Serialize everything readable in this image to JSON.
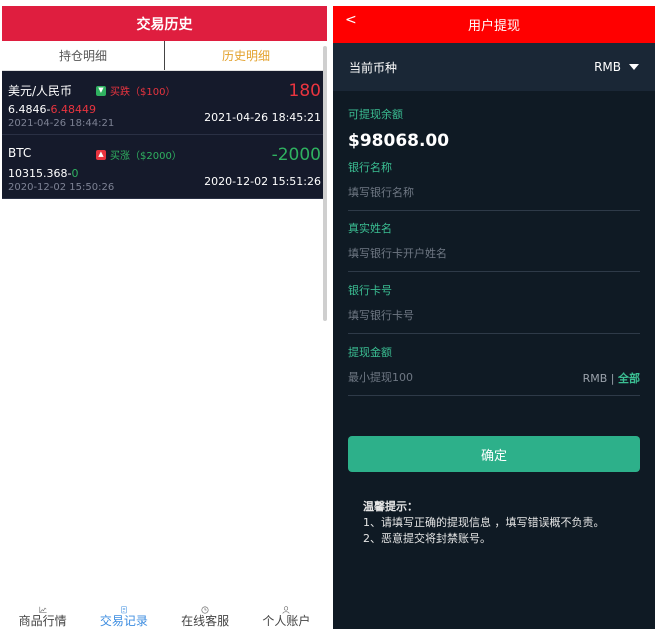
{
  "left": {
    "title": "交易历史",
    "tabs": [
      {
        "label": "持仓明细",
        "active": false
      },
      {
        "label": "历史明细",
        "active": true
      }
    ],
    "orders": [
      {
        "name": "美元/人民币",
        "direction": "down",
        "badge_label": "买跌（$100）",
        "open_price": "6.4846",
        "close_price": "6.48449",
        "open_time": "2021-04-26 18:44:21",
        "profit": "180",
        "close_time": "2021-04-26 18:45:21"
      },
      {
        "name": "BTC",
        "direction": "up",
        "badge_label": "买涨（$2000）",
        "open_price": "10315.368",
        "close_price": "0",
        "open_time": "2020-12-02 15:50:26",
        "profit": "-2000",
        "close_time": "2020-12-02 15:51:26"
      }
    ],
    "nav": [
      {
        "label": "商品行情",
        "icon": "chart-icon",
        "active": false
      },
      {
        "label": "交易记录",
        "icon": "records-icon",
        "active": true
      },
      {
        "label": "在线客服",
        "icon": "clock-icon",
        "active": false
      },
      {
        "label": "个人账户",
        "icon": "user-icon",
        "active": false
      }
    ]
  },
  "right": {
    "title": "用户提现",
    "back_icon": "chevron-left-icon",
    "currency_label": "当前币种",
    "currency_value": "RMB",
    "balance_label": "可提现余额",
    "balance": "$98068.00",
    "bank_name_label": "银行名称",
    "bank_name_placeholder": "填写银行名称",
    "real_name_label": "真实姓名",
    "real_name_placeholder": "填写银行卡开户姓名",
    "card_label": "银行卡号",
    "card_placeholder": "填写银行卡号",
    "amount_label": "提现金额",
    "amount_placeholder": "最小提现100",
    "amount_unit": "RMB",
    "amount_separator": "|",
    "amount_all": "全部",
    "confirm_label": "确定",
    "tips_title": "温馨提示：",
    "tips": [
      "1、请填写正确的提现信息 ，填写错误概不负责。",
      "2、恶意提交将封禁账号。"
    ]
  },
  "colors": {
    "header_red": "#df1e3f",
    "title_red": "#ff0000",
    "accent_green": "#2db08a",
    "label_green": "#3bbf93",
    "loss_red": "#e9343f",
    "gain_green": "#2fb160",
    "dark_bg": "#0f1a24",
    "tab_active": "#e3a12b"
  }
}
